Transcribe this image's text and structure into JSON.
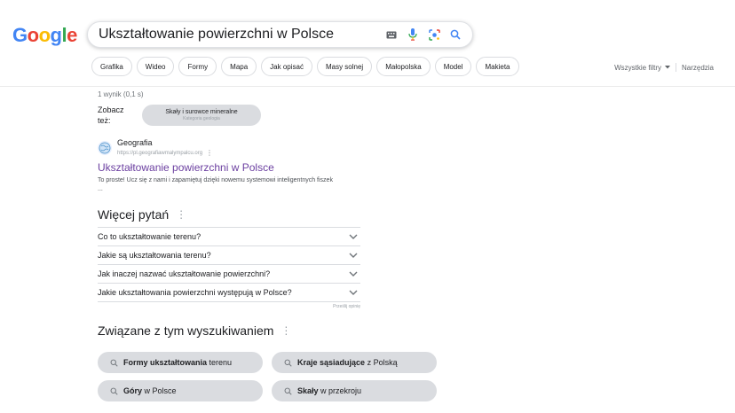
{
  "logo": {
    "text": "Google",
    "colors": [
      "#4285F4",
      "#EA4335",
      "#FBBC05",
      "#4285F4",
      "#34A853",
      "#EA4335"
    ]
  },
  "search": {
    "query": "Ukształtowanie powierzchni w Polsce"
  },
  "chips": [
    "Grafika",
    "Wideo",
    "Formy",
    "Mapa",
    "Jak opisać",
    "Masy solnej",
    "Małopolska",
    "Model",
    "Makieta"
  ],
  "tools": {
    "filters": "Wszystkie filtry",
    "tools": "Narzędzia"
  },
  "stats": "1 wynik (0,1 s)",
  "see_also": {
    "label": "Zobacz też:",
    "chip_title": "Skały i surowce mineralne",
    "chip_subtitle": "Kategoria geologia"
  },
  "result": {
    "site": "Geografia",
    "url": "https://pl.geografiawmalympalcu.org",
    "title": "Ukształtowanie powierzchni w Polsce",
    "snippet": "To proste! Ucz się z nami i zapamiętuj dzięki nowemu systemowi inteligentnych fiszek ..."
  },
  "paa": {
    "title": "Więcej pytań",
    "questions": [
      "Co to ukształtowanie terenu?",
      "Jakie są ukształtowania terenu?",
      "Jak inaczej nazwać ukształtowanie powierzchni?",
      "Jakie ukształtowania powierzchni występują w Polsce?"
    ],
    "feedback": "Prześlij opinię"
  },
  "related": {
    "title": "Związane z tym wyszukiwaniem",
    "items": [
      {
        "bold": "Formy ukształtowania",
        "rest": " terenu"
      },
      {
        "bold": "Kraje sąsiadujące",
        "rest": " z Polską"
      },
      {
        "bold": "Góry",
        "rest": " w Polsce"
      },
      {
        "bold": "Skały",
        "rest": " w przekroju"
      }
    ]
  }
}
